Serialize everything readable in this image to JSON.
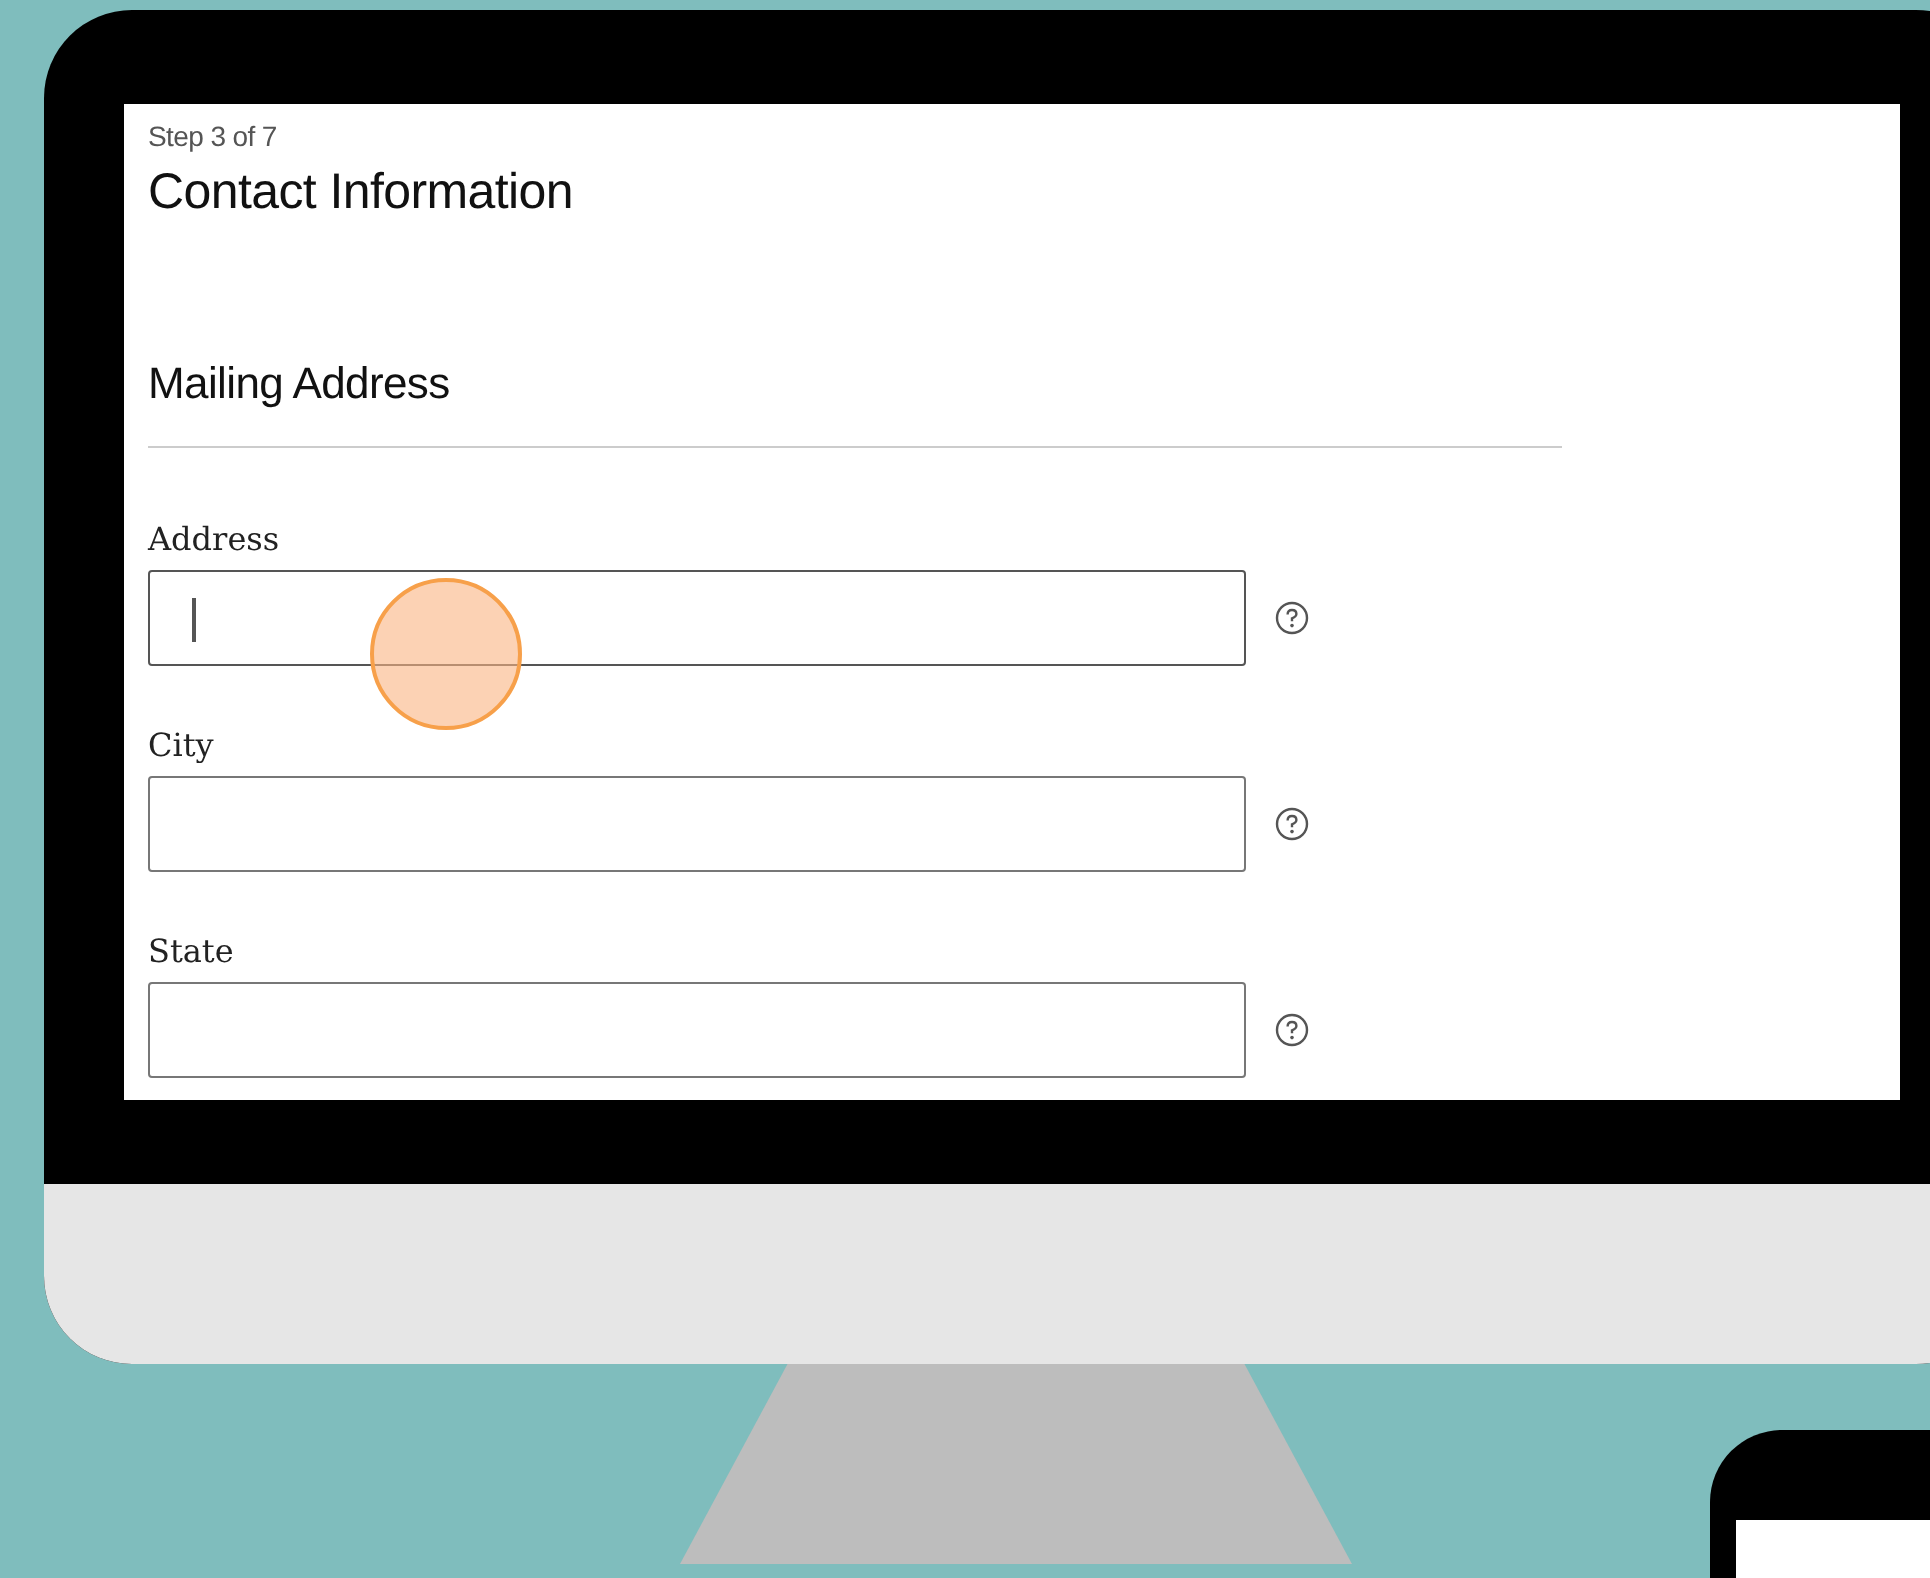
{
  "form": {
    "step": "Step 3 of 7",
    "title": "Contact Information",
    "section": "Mailing Address",
    "fields": [
      {
        "label": "Address",
        "focused": true
      },
      {
        "label": "City",
        "focused": false
      },
      {
        "label": "State",
        "focused": false
      }
    ]
  }
}
